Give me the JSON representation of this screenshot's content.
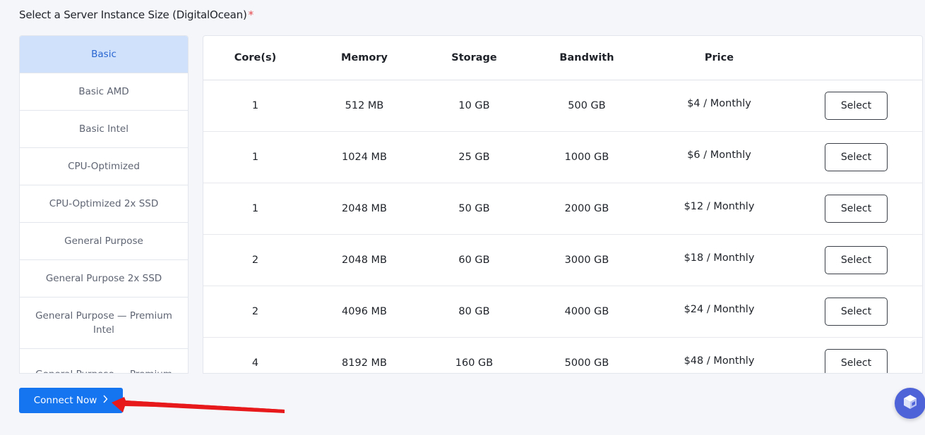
{
  "page": {
    "title": "Select a Server Instance Size (DigitalOcean)",
    "required_mark": "*"
  },
  "types": [
    {
      "label": "Basic",
      "active": true
    },
    {
      "label": "Basic AMD",
      "active": false
    },
    {
      "label": "Basic Intel",
      "active": false
    },
    {
      "label": "CPU-Optimized",
      "active": false
    },
    {
      "label": "CPU-Optimized 2x SSD",
      "active": false
    },
    {
      "label": "General Purpose",
      "active": false
    },
    {
      "label": "General Purpose 2x SSD",
      "active": false
    },
    {
      "label": "General Purpose — Premium Intel",
      "active": false
    },
    {
      "label": "General Purpose — Premium",
      "active": false
    }
  ],
  "table": {
    "headers": [
      "Core(s)",
      "Memory",
      "Storage",
      "Bandwith",
      "Price",
      ""
    ],
    "select_label": "Select",
    "rows": [
      {
        "cores": "1",
        "memory": "512 MB",
        "storage": "10 GB",
        "bandwidth": "500 GB",
        "price": "$4 / Monthly"
      },
      {
        "cores": "1",
        "memory": "1024 MB",
        "storage": "25 GB",
        "bandwidth": "1000 GB",
        "price": "$6 / Monthly"
      },
      {
        "cores": "1",
        "memory": "2048 MB",
        "storage": "50 GB",
        "bandwidth": "2000 GB",
        "price": "$12 / Monthly"
      },
      {
        "cores": "2",
        "memory": "2048 MB",
        "storage": "60 GB",
        "bandwidth": "3000 GB",
        "price": "$18 / Monthly"
      },
      {
        "cores": "2",
        "memory": "4096 MB",
        "storage": "80 GB",
        "bandwidth": "4000 GB",
        "price": "$24 / Monthly"
      },
      {
        "cores": "4",
        "memory": "8192 MB",
        "storage": "160 GB",
        "bandwidth": "5000 GB",
        "price": "$48 / Monthly"
      }
    ]
  },
  "actions": {
    "connect_label": "Connect Now",
    "connect_icon": "chevron-right-icon"
  },
  "colors": {
    "accent": "#1574f0",
    "active_tab_bg": "#cfe1fb",
    "active_tab_text": "#2a66d1",
    "annotation_arrow": "#e8191b",
    "fab": "#4f63d9"
  }
}
